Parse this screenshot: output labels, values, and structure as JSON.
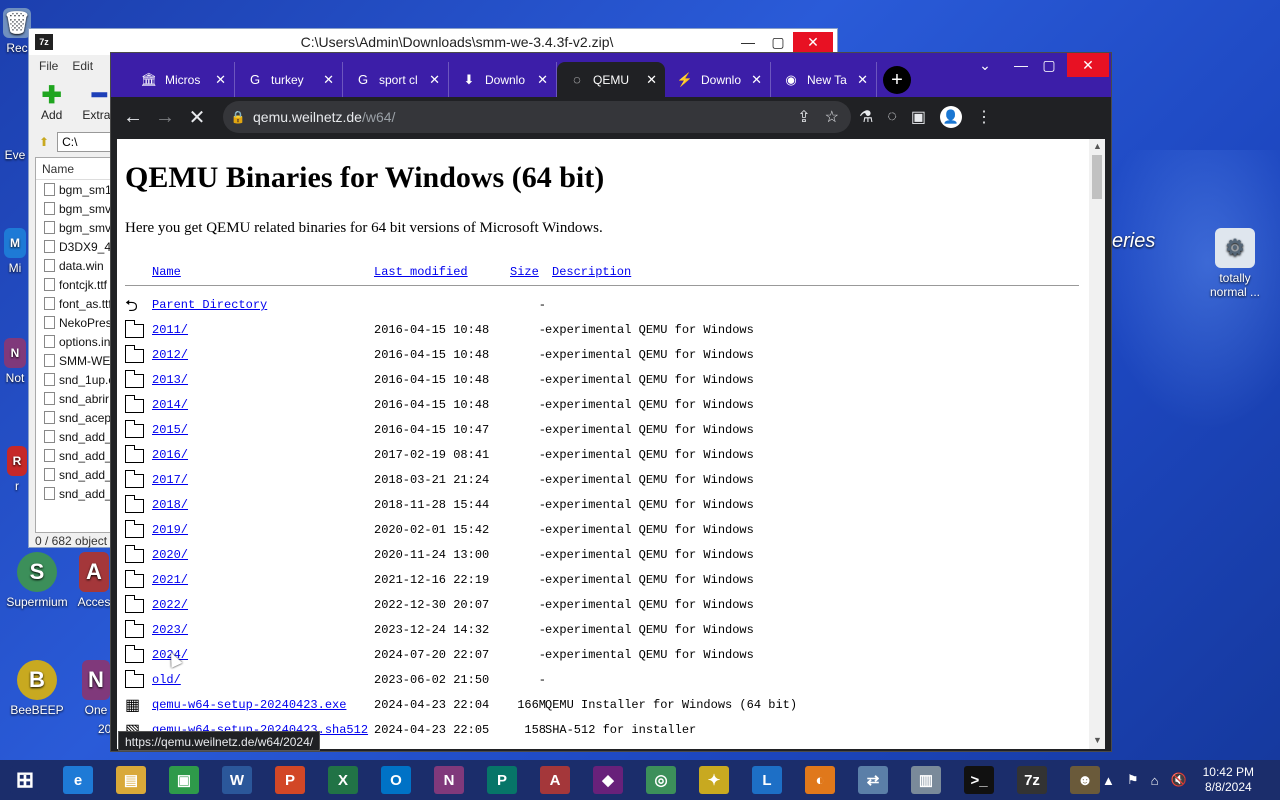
{
  "desktop": {
    "icons": [
      {
        "label": "Rec",
        "glyph": "🗑"
      },
      {
        "label": "Eve",
        "glyph": "E"
      },
      {
        "label": "Mi",
        "glyph": "M"
      },
      {
        "label": "Not",
        "glyph": "N"
      },
      {
        "label": "r",
        "glyph": "R"
      },
      {
        "label": "Supermium",
        "glyph": "S"
      },
      {
        "label": "Acces",
        "glyph": "A"
      },
      {
        "label": "BeeBEEP",
        "glyph": "B"
      },
      {
        "label": "One",
        "glyph": "N"
      },
      {
        "label": "totally normal ...",
        "glyph": "⚙"
      }
    ],
    "wallpaper_text": "eries",
    "extra_label": "20"
  },
  "zip_window": {
    "title": "C:\\Users\\Admin\\Downloads\\smm-we-3.4.3f-v2.zip\\",
    "logo": "7z",
    "menu": [
      "File",
      "Edit"
    ],
    "toolbar": [
      "Add",
      "Extrac"
    ],
    "path_value": "C:\\",
    "column_name": "Name",
    "files": [
      "bgm_sm1",
      "bgm_smv",
      "bgm_smv",
      "D3DX9_43",
      "data.win",
      "fontcjk.ttf",
      "font_as.ttf",
      "NekoPres",
      "options.in",
      "SMM-WE",
      "snd_1up.o",
      "snd_abrir",
      "snd_acept",
      "snd_add_",
      "snd_add_",
      "snd_add_f",
      "snd_add_"
    ],
    "status": "0 / 682 object"
  },
  "chrome": {
    "tabs": [
      {
        "label": "Micros",
        "icon": "🏛",
        "active": false
      },
      {
        "label": "turkey",
        "icon": "G",
        "active": false
      },
      {
        "label": "sport cl",
        "icon": "G",
        "active": false
      },
      {
        "label": "Downlo",
        "icon": "⬇",
        "active": false
      },
      {
        "label": "QEMU",
        "icon": "◌",
        "active": true
      },
      {
        "label": "Downlo",
        "icon": "⚡",
        "active": false
      },
      {
        "label": "New Ta",
        "icon": "◉",
        "active": false
      }
    ],
    "new_tab": "+",
    "window_controls": {
      "dropdown": "⌄",
      "minimize": "—",
      "maximize": "▢",
      "close": "✕"
    },
    "url_host": "qemu.weilnetz.de",
    "url_path": "/w64/",
    "status_url": "https://qemu.weilnetz.de/w64/2024/"
  },
  "page": {
    "title": "QEMU Binaries for Windows (64 bit)",
    "intro": "Here you get QEMU related binaries for 64 bit versions of Microsoft Windows.",
    "columns": {
      "name": "Name",
      "modified": "Last modified",
      "size": "Size",
      "description": "Description"
    },
    "parent": {
      "name": "Parent Directory",
      "size": "-"
    },
    "entries": [
      {
        "name": "2011/",
        "modified": "2016-04-15 10:48",
        "size": "-",
        "description": "experimental QEMU for Windows",
        "type": "folder"
      },
      {
        "name": "2012/",
        "modified": "2016-04-15 10:48",
        "size": "-",
        "description": "experimental QEMU for Windows",
        "type": "folder"
      },
      {
        "name": "2013/",
        "modified": "2016-04-15 10:48",
        "size": "-",
        "description": "experimental QEMU for Windows",
        "type": "folder"
      },
      {
        "name": "2014/",
        "modified": "2016-04-15 10:48",
        "size": "-",
        "description": "experimental QEMU for Windows",
        "type": "folder"
      },
      {
        "name": "2015/",
        "modified": "2016-04-15 10:47",
        "size": "-",
        "description": "experimental QEMU for Windows",
        "type": "folder"
      },
      {
        "name": "2016/",
        "modified": "2017-02-19 08:41",
        "size": "-",
        "description": "experimental QEMU for Windows",
        "type": "folder"
      },
      {
        "name": "2017/",
        "modified": "2018-03-21 21:24",
        "size": "-",
        "description": "experimental QEMU for Windows",
        "type": "folder"
      },
      {
        "name": "2018/",
        "modified": "2018-11-28 15:44",
        "size": "-",
        "description": "experimental QEMU for Windows",
        "type": "folder"
      },
      {
        "name": "2019/",
        "modified": "2020-02-01 15:42",
        "size": "-",
        "description": "experimental QEMU for Windows",
        "type": "folder"
      },
      {
        "name": "2020/",
        "modified": "2020-11-24 13:00",
        "size": "-",
        "description": "experimental QEMU for Windows",
        "type": "folder"
      },
      {
        "name": "2021/",
        "modified": "2021-12-16 22:19",
        "size": "-",
        "description": "experimental QEMU for Windows",
        "type": "folder"
      },
      {
        "name": "2022/",
        "modified": "2022-12-30 20:07",
        "size": "-",
        "description": "experimental QEMU for Windows",
        "type": "folder"
      },
      {
        "name": "2023/",
        "modified": "2023-12-24 14:32",
        "size": "-",
        "description": "experimental QEMU for Windows",
        "type": "folder"
      },
      {
        "name": "2024/",
        "modified": "2024-07-20 22:07",
        "size": "-",
        "description": "experimental QEMU for Windows",
        "type": "folder"
      },
      {
        "name": "old/",
        "modified": "2023-06-02 21:50",
        "size": "-",
        "description": "",
        "type": "folder"
      },
      {
        "name": "qemu-w64-setup-20240423.exe",
        "modified": "2024-04-23 22:04",
        "size": "166M",
        "description": "QEMU Installer for Windows (64 bit)",
        "type": "binary"
      },
      {
        "name": "qemu-w64-setup-20240423.sha512",
        "modified": "2024-04-23 22:05",
        "size": "158",
        "description": "SHA-512 for installer",
        "type": "text"
      }
    ]
  },
  "taskbar": {
    "apps": [
      {
        "name": "start",
        "glyph": "⊞",
        "color": "#1b2d6b"
      },
      {
        "name": "internet-explorer",
        "glyph": "e",
        "color": "#1e7ad6"
      },
      {
        "name": "file-explorer",
        "glyph": "▤",
        "color": "#d9a93a"
      },
      {
        "name": "store",
        "glyph": "▣",
        "color": "#2e9a4a"
      },
      {
        "name": "word",
        "glyph": "W",
        "color": "#2b579a"
      },
      {
        "name": "powerpoint",
        "glyph": "P",
        "color": "#d24726"
      },
      {
        "name": "excel",
        "glyph": "X",
        "color": "#217346"
      },
      {
        "name": "outlook",
        "glyph": "O",
        "color": "#0072c6"
      },
      {
        "name": "onenote",
        "glyph": "N",
        "color": "#80397b"
      },
      {
        "name": "publisher",
        "glyph": "P",
        "color": "#077568"
      },
      {
        "name": "access",
        "glyph": "A",
        "color": "#a4373a"
      },
      {
        "name": "visual-studio",
        "glyph": "◆",
        "color": "#68217a"
      },
      {
        "name": "supermium",
        "glyph": "◎",
        "color": "#3c8f5a"
      },
      {
        "name": "beebeep",
        "glyph": "✦",
        "color": "#c8a920"
      },
      {
        "name": "lync",
        "glyph": "L",
        "color": "#1d6fc6"
      },
      {
        "name": "ball-app",
        "glyph": "◐",
        "color": "#e0781b"
      },
      {
        "name": "network-app",
        "glyph": "⇄",
        "color": "#5b7fa8"
      },
      {
        "name": "archive-app",
        "glyph": "▥",
        "color": "#7a8a9a"
      },
      {
        "name": "terminal",
        "glyph": ">_",
        "color": "#111111"
      },
      {
        "name": "seven-zip",
        "glyph": "7z",
        "color": "#333333"
      },
      {
        "name": "gimp-like",
        "glyph": "☻",
        "color": "#6a5a3a"
      }
    ],
    "tray_icons": [
      "▲",
      "⚑",
      "⌂",
      "🔇"
    ],
    "time": "10:42 PM",
    "date": "8/8/2024"
  }
}
